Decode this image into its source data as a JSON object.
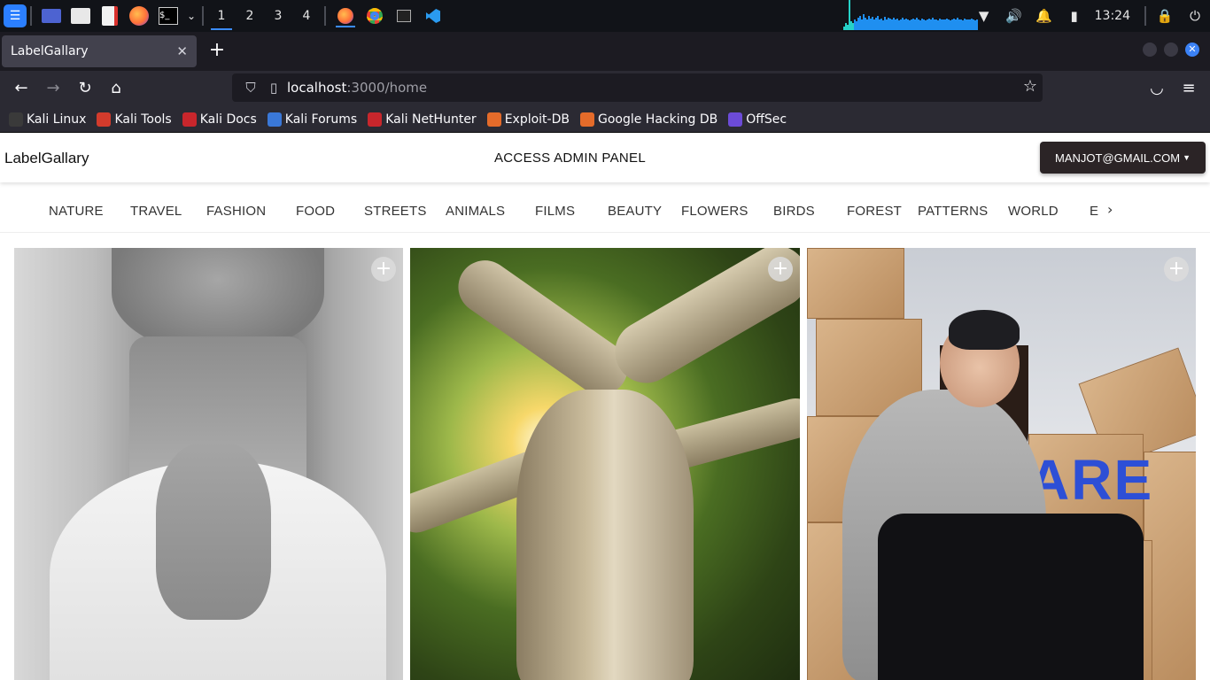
{
  "taskbar": {
    "workspaces": [
      "1",
      "2",
      "3",
      "4"
    ],
    "clock": "13:24"
  },
  "browser": {
    "tab_title": "LabelGallary",
    "url_host": "localhost",
    "url_path": ":3000/home",
    "bookmarks": [
      {
        "label": "Kali Linux",
        "color": "#3a3a3a"
      },
      {
        "label": "Kali Tools",
        "color": "#d33b2c"
      },
      {
        "label": "Kali Docs",
        "color": "#c8262c"
      },
      {
        "label": "Kali Forums",
        "color": "#3a78d8"
      },
      {
        "label": "Kali NetHunter",
        "color": "#c8262c"
      },
      {
        "label": "Exploit-DB",
        "color": "#e46b2a"
      },
      {
        "label": "Google Hacking DB",
        "color": "#e46b2a"
      },
      {
        "label": "OffSec",
        "color": "#6c4bd8"
      }
    ]
  },
  "site": {
    "brand": "LabelGallary",
    "admin_link": "ACCESS ADMIN PANEL",
    "user_email": "MANJOT@GMAIL.COM",
    "categories": [
      "NATURE",
      "TRAVEL",
      "FASHION",
      "FOOD",
      "STREETS",
      "ANIMALS",
      "FILMS",
      "BEAUTY",
      "FLOWERS",
      "BIRDS",
      "FOREST",
      "PATTERNS",
      "WORLD",
      "E"
    ],
    "graffiti_text": "ARE"
  },
  "colors": {
    "accent": "#3b8cff",
    "user_button_bg": "#2b2426"
  }
}
